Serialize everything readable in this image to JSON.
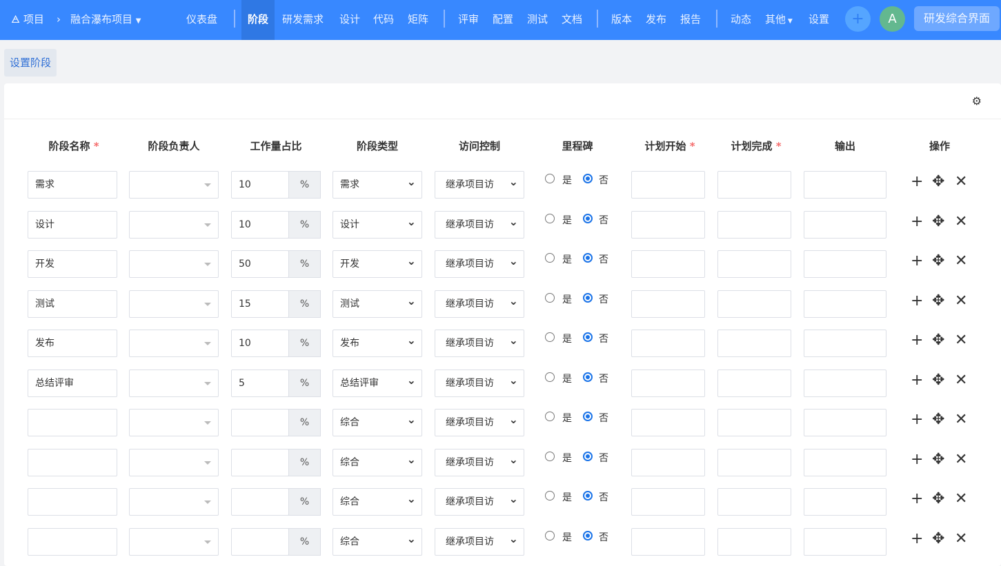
{
  "nav": {
    "project": "项目",
    "project_name": "融合瀑布项目",
    "dashboard": "仪表盘",
    "items": [
      "阶段",
      "研发需求",
      "设计",
      "代码",
      "矩阵",
      "评审",
      "配置",
      "测试",
      "文档",
      "版本",
      "发布",
      "报告",
      "动态",
      "其他",
      "设置"
    ],
    "active": "阶段",
    "avatar": "A",
    "app_button": "研发综合界面"
  },
  "tab": "设置阶段",
  "headers": [
    "阶段名称",
    "阶段负责人",
    "工作量占比",
    "阶段类型",
    "访问控制",
    "里程碑",
    "计划开始",
    "计划完成",
    "输出",
    "操作"
  ],
  "required": [
    true,
    false,
    false,
    false,
    false,
    false,
    true,
    true,
    false,
    false
  ],
  "percent": "%",
  "yes": "是",
  "no": "否",
  "rows": [
    {
      "name": "需求",
      "ratio": "10",
      "type": "需求",
      "access": "继承项目访",
      "milestone": false
    },
    {
      "name": "设计",
      "ratio": "10",
      "type": "设计",
      "access": "继承项目访",
      "milestone": false
    },
    {
      "name": "开发",
      "ratio": "50",
      "type": "开发",
      "access": "继承项目访",
      "milestone": false
    },
    {
      "name": "测试",
      "ratio": "15",
      "type": "测试",
      "access": "继承项目访",
      "milestone": false
    },
    {
      "name": "发布",
      "ratio": "10",
      "type": "发布",
      "access": "继承项目访",
      "milestone": false
    },
    {
      "name": "总结评审",
      "ratio": "5",
      "type": "总结评审",
      "access": "继承项目访",
      "milestone": false
    },
    {
      "name": "",
      "ratio": "",
      "type": "综合",
      "access": "继承项目访",
      "milestone": false
    },
    {
      "name": "",
      "ratio": "",
      "type": "综合",
      "access": "继承项目访",
      "milestone": false
    },
    {
      "name": "",
      "ratio": "",
      "type": "综合",
      "access": "继承项目访",
      "milestone": false
    },
    {
      "name": "",
      "ratio": "",
      "type": "综合",
      "access": "继承项目访",
      "milestone": false
    }
  ]
}
